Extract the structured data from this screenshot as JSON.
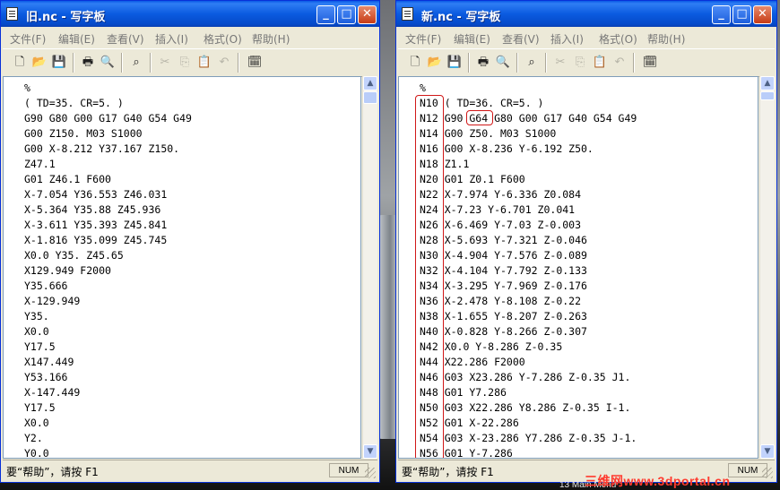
{
  "left_window": {
    "title": "旧.nc - 写字板",
    "menu": [
      "文件(F)",
      "编辑(E)",
      "查看(V)",
      "插入(I)",
      "格式(O)",
      "帮助(H)"
    ],
    "lines": [
      "%",
      "( TD=35. CR=5. )",
      "G90 G80 G00 G17 G40 G54 G49",
      "G00 Z150. M03 S1000",
      "G00 X-8.212 Y37.167 Z150.",
      "Z47.1",
      "G01 Z46.1 F600",
      "X-7.054 Y36.553 Z46.031",
      "X-5.364 Y35.88 Z45.936",
      "X-3.611 Y35.393 Z45.841",
      "X-1.816 Y35.099 Z45.745",
      "X0.0 Y35. Z45.65",
      "X129.949 F2000",
      "Y35.666",
      "X-129.949",
      "Y35.",
      "X0.0",
      "Y17.5",
      "X147.449",
      "Y53.166",
      "X-147.449",
      "Y17.5",
      "X0.0",
      "Y2.",
      "Y0.0"
    ],
    "status": "要“帮助”，请按 F1",
    "num": "NUM"
  },
  "right_window": {
    "title": "新.nc - 写字板",
    "menu": [
      "文件(F)",
      "编辑(E)",
      "查看(V)",
      "插入(I)",
      "格式(O)",
      "帮助(H)"
    ],
    "lines": [
      "%",
      "N10 ( TD=36. CR=5. )",
      "N12 G90 G64 G80 G00 G17 G40 G54 G49",
      "N14 G00 Z50. M03 S1000",
      "N16 G00 X-8.236 Y-6.192 Z50.",
      "N18 Z1.1",
      "N20 G01 Z0.1 F600",
      "N22 X-7.974 Y-6.336 Z0.084",
      "N24 X-7.23 Y-6.701 Z0.041",
      "N26 X-6.469 Y-7.03 Z-0.003",
      "N28 X-5.693 Y-7.321 Z-0.046",
      "N30 X-4.904 Y-7.576 Z-0.089",
      "N32 X-4.104 Y-7.792 Z-0.133",
      "N34 X-3.295 Y-7.969 Z-0.176",
      "N36 X-2.478 Y-8.108 Z-0.22",
      "N38 X-1.655 Y-8.207 Z-0.263",
      "N40 X-0.828 Y-8.266 Z-0.307",
      "N42 X0.0 Y-8.286 Z-0.35",
      "N44 X22.286 F2000",
      "N46 G03 X23.286 Y-7.286 Z-0.35 J1.",
      "N48 G01 Y7.286",
      "N50 G03 X22.286 Y8.286 Z-0.35 I-1.",
      "N52 G01 X-22.286",
      "N54 G03 X-23.286 Y7.286 Z-0.35 J-1.",
      "N56 G01 Y-7.286"
    ],
    "status": "要“帮助”，请按 F1",
    "num": "NUM"
  },
  "overlay": {
    "watermark": "三维网www.3dportal.cn",
    "note": "13 Main Menu"
  }
}
